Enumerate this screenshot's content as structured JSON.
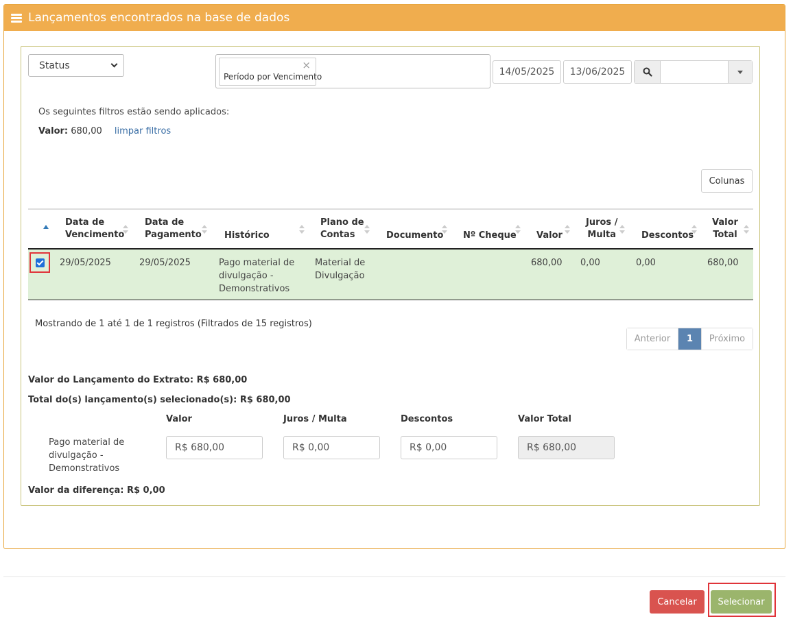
{
  "panel": {
    "title": "Lançamentos encontrados na base de dados"
  },
  "filters": {
    "status_select": "Status",
    "period_tag": "Período por Vencimento",
    "date_from": "14/05/2025",
    "date_to": "13/06/2025",
    "search_value": "",
    "applied_text": "Os seguintes filtros estão sendo aplicados:",
    "applied_label": "Valor:",
    "applied_value": "680,00",
    "clear_link": "limpar filtros"
  },
  "columns_button": "Colunas",
  "table": {
    "headers": {
      "vencimento": [
        "Data de",
        "Vencimento"
      ],
      "pagamento": [
        "Data de",
        "Pagamento"
      ],
      "historico": "Histórico",
      "plano": [
        "Plano de",
        "Contas"
      ],
      "documento": "Documento",
      "cheque": "Nº Cheque",
      "valor": "Valor",
      "juros": [
        "Juros /",
        "Multa"
      ],
      "descontos": "Descontos",
      "total": [
        "Valor",
        "Total"
      ]
    },
    "rows": [
      {
        "checked": true,
        "vencimento": "29/05/2025",
        "pagamento": "29/05/2025",
        "historico": [
          "Pago material de",
          "divulgação -",
          "Demonstrativos"
        ],
        "plano": [
          "Material de",
          "Divulgação"
        ],
        "documento": "",
        "cheque": "",
        "valor": "680,00",
        "juros": "0,00",
        "descontos": "0,00",
        "total": "680,00"
      }
    ]
  },
  "info_text": "Mostrando de 1 até 1 de 1 registros (Filtrados de 15 registros)",
  "pager": {
    "prev": "Anterior",
    "current": "1",
    "next": "Próximo"
  },
  "summary": {
    "extrato": "Valor do Lançamento do Extrato: R$ 680,00",
    "selecionados": "Total do(s) lançamento(s) selecionado(s): R$ 680,00",
    "col_valor": "Valor",
    "col_juros": "Juros / Multa",
    "col_descontos": "Descontos",
    "col_total": "Valor Total",
    "item_label": [
      "Pago material de",
      "divulgação -",
      "Demonstrativos"
    ],
    "valor": "R$ 680,00",
    "juros": "R$ 0,00",
    "descontos": "R$ 0,00",
    "total": "R$ 680,00",
    "diferenca": "Valor da diferença: R$ 0,00"
  },
  "footer": {
    "cancel": "Cancelar",
    "select": "Selecionar"
  },
  "colors": {
    "header": "#f0ad4e",
    "row_selected": "#dff0d8",
    "cancel": "#d9534f",
    "select": "#9bb56c",
    "highlight": "#e0343a"
  }
}
